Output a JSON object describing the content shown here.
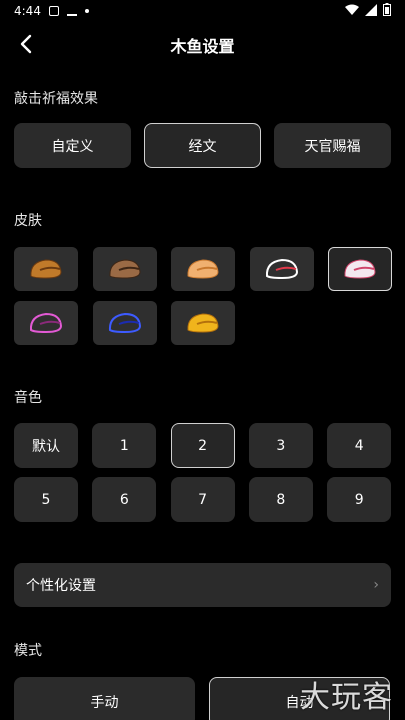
{
  "status_bar": {
    "time": "4:44"
  },
  "header": {
    "title": "木鱼设置"
  },
  "effect_section": {
    "title": "敲击祈福效果",
    "options": [
      {
        "label": "自定义",
        "selected": false
      },
      {
        "label": "经文",
        "selected": true
      },
      {
        "label": "天官赐福",
        "selected": false
      }
    ]
  },
  "skin_section": {
    "title": "皮肤",
    "skins": [
      {
        "icon": "wooden-fish-brown-icon",
        "colors": [
          "#c07a2a",
          "#6b3a10"
        ],
        "selected": false
      },
      {
        "icon": "wooden-fish-dark-icon",
        "colors": [
          "#9a6a45",
          "#3e2615"
        ],
        "selected": false
      },
      {
        "icon": "wooden-fish-light-icon",
        "colors": [
          "#f0b070",
          "#c8782e"
        ],
        "selected": false
      },
      {
        "icon": "wooden-fish-outline-white-icon",
        "colors": [
          "#ffffff",
          "#e23a4b"
        ],
        "selected": false
      },
      {
        "icon": "wooden-fish-cat-icon",
        "colors": [
          "#f3e8ef",
          "#d0446a"
        ],
        "selected": true
      },
      {
        "icon": "wooden-fish-pink-outline-icon",
        "colors": [
          "#e25ad4",
          "#8a2a7a"
        ],
        "selected": false
      },
      {
        "icon": "wooden-fish-blue-outline-icon",
        "colors": [
          "#3d5bff",
          "#1c2cb0"
        ],
        "selected": false
      },
      {
        "icon": "wooden-fish-gold-icon",
        "colors": [
          "#f0b41c",
          "#b3700c"
        ],
        "selected": false
      }
    ]
  },
  "sound_section": {
    "title": "音色",
    "options": [
      {
        "label": "默认",
        "selected": false
      },
      {
        "label": "1",
        "selected": false
      },
      {
        "label": "2",
        "selected": true
      },
      {
        "label": "3",
        "selected": false
      },
      {
        "label": "4",
        "selected": false
      },
      {
        "label": "5",
        "selected": false
      },
      {
        "label": "6",
        "selected": false
      },
      {
        "label": "7",
        "selected": false
      },
      {
        "label": "8",
        "selected": false
      },
      {
        "label": "9",
        "selected": false
      }
    ]
  },
  "personalize": {
    "label": "个性化设置",
    "chevron": "›"
  },
  "mode_section": {
    "title": "模式",
    "options": [
      {
        "label": "手动",
        "selected": false
      },
      {
        "label": "自动",
        "selected": true
      }
    ]
  },
  "watermark": {
    "text": "大玩客"
  }
}
